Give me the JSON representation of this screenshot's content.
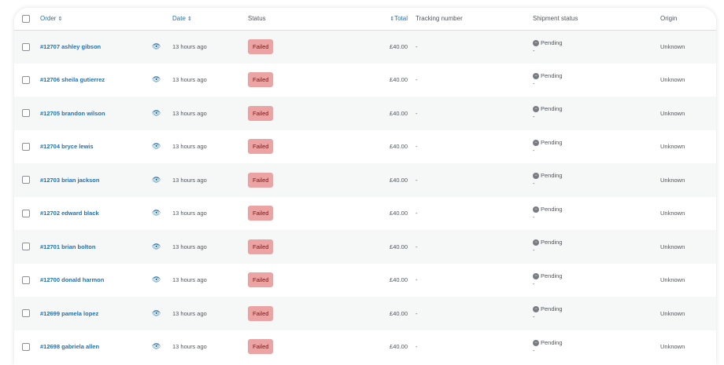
{
  "columns": {
    "order": "Order",
    "date": "Date",
    "status": "Status",
    "total": "Total",
    "tracking": "Tracking number",
    "shipment": "Shipment status",
    "origin": "Origin"
  },
  "icons": {
    "sort": "sort-arrows-icon",
    "preview": "eye-icon",
    "pending": "pending-circle-icon"
  },
  "colors": {
    "link": "#2271b1",
    "failed_bg": "#eba3a3",
    "failed_text": "#761919"
  },
  "orders": [
    {
      "label": "#12707 ashley gibson",
      "date": "13 hours ago",
      "status": "Failed",
      "total": "£40.00",
      "tracking": "-",
      "shipment": "Pending",
      "shipment_sub": "-",
      "origin": "Unknown"
    },
    {
      "label": "#12706 sheila gutierrez",
      "date": "13 hours ago",
      "status": "Failed",
      "total": "£40.00",
      "tracking": "-",
      "shipment": "Pending",
      "shipment_sub": "-",
      "origin": "Unknown"
    },
    {
      "label": "#12705 brandon wilson",
      "date": "13 hours ago",
      "status": "Failed",
      "total": "£40.00",
      "tracking": "-",
      "shipment": "Pending",
      "shipment_sub": "-",
      "origin": "Unknown"
    },
    {
      "label": "#12704 bryce lewis",
      "date": "13 hours ago",
      "status": "Failed",
      "total": "£40.00",
      "tracking": "-",
      "shipment": "Pending",
      "shipment_sub": "-",
      "origin": "Unknown"
    },
    {
      "label": "#12703 brian jackson",
      "date": "13 hours ago",
      "status": "Failed",
      "total": "£40.00",
      "tracking": "-",
      "shipment": "Pending",
      "shipment_sub": "-",
      "origin": "Unknown"
    },
    {
      "label": "#12702 edward black",
      "date": "13 hours ago",
      "status": "Failed",
      "total": "£40.00",
      "tracking": "-",
      "shipment": "Pending",
      "shipment_sub": "-",
      "origin": "Unknown"
    },
    {
      "label": "#12701 brian bolton",
      "date": "13 hours ago",
      "status": "Failed",
      "total": "£40.00",
      "tracking": "-",
      "shipment": "Pending",
      "shipment_sub": "-",
      "origin": "Unknown"
    },
    {
      "label": "#12700 donald harmon",
      "date": "13 hours ago",
      "status": "Failed",
      "total": "£40.00",
      "tracking": "-",
      "shipment": "Pending",
      "shipment_sub": "-",
      "origin": "Unknown"
    },
    {
      "label": "#12699 pamela lopez",
      "date": "13 hours ago",
      "status": "Failed",
      "total": "£40.00",
      "tracking": "-",
      "shipment": "Pending",
      "shipment_sub": "-",
      "origin": "Unknown"
    },
    {
      "label": "#12698 gabriela allen",
      "date": "13 hours ago",
      "status": "Failed",
      "total": "£40.00",
      "tracking": "-",
      "shipment": "Pending",
      "shipment_sub": "-",
      "origin": "Unknown"
    }
  ]
}
